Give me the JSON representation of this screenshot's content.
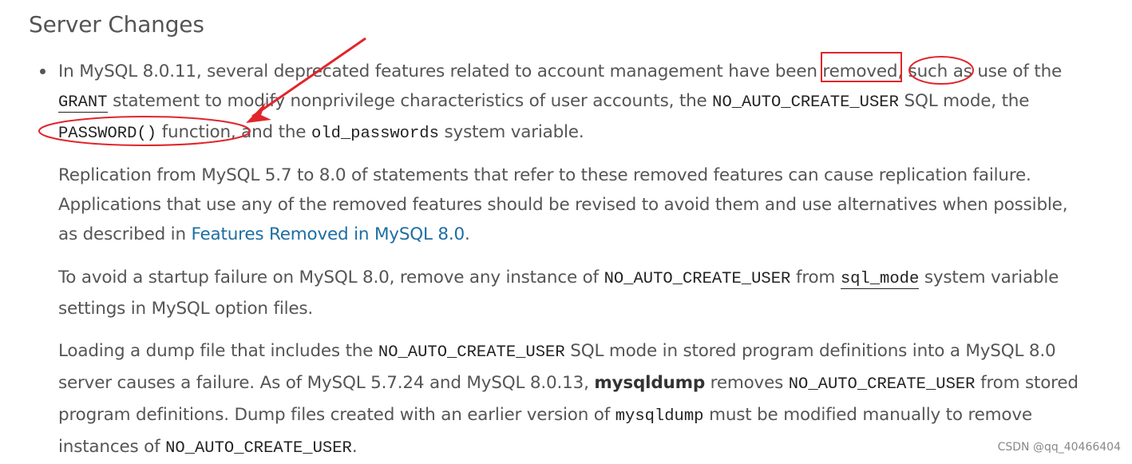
{
  "section": {
    "title": "Server Changes"
  },
  "bullet_paragraph": {
    "t1": "In MySQL 8.0.11, several deprecated features related to account management have been ",
    "removed": "removed",
    "t2": ", ",
    "such_as": "such as",
    "t3": " use of the ",
    "grant": "GRANT",
    "t4": " statement to modify nonprivilege characteristics of user accounts, the ",
    "no_auto": "NO_AUTO_CREATE_USER",
    "t5": " SQL mode, the ",
    "password_fn": "PASSWORD()",
    "t6": " function, and the ",
    "old_passwords": "old_passwords",
    "t7": " system variable."
  },
  "replication_paragraph": {
    "t1": "Replication from MySQL 5.7 to 8.0 of statements that refer to these removed features can cause replication failure. Applications that use any of the removed features should be revised to avoid them and use alternatives when possible, as described in ",
    "link": "Features Removed in MySQL 8.0",
    "t2": "."
  },
  "startup_paragraph": {
    "t1": "To avoid a startup failure on MySQL 8.0, remove any instance of ",
    "no_auto": "NO_AUTO_CREATE_USER",
    "t2": " from ",
    "sql_mode": "sql_mode",
    "t3": " system variable settings in MySQL option files."
  },
  "dump_paragraph": {
    "t1": "Loading a dump file that includes the ",
    "no_auto_1": "NO_AUTO_CREATE_USER",
    "t2": " SQL mode in stored program definitions into a MySQL 8.0 server causes a failure. As of MySQL 5.7.24 and MySQL 8.0.13, ",
    "mysqldump_bold": "mysqldump",
    "t3": " removes ",
    "no_auto_2": "NO_AUTO_CREATE_USER",
    "t4": " from stored program definitions. Dump files created with an earlier version of ",
    "mysqldump_code": "mysqldump",
    "t5": " must be modified manually to remove instances of ",
    "no_auto_3": "NO_AUTO_CREATE_USER",
    "t6": "."
  },
  "watermark": "CSDN @qq_40466404",
  "annotation_color": "#e0262b",
  "link_color": "#1d6ea3"
}
